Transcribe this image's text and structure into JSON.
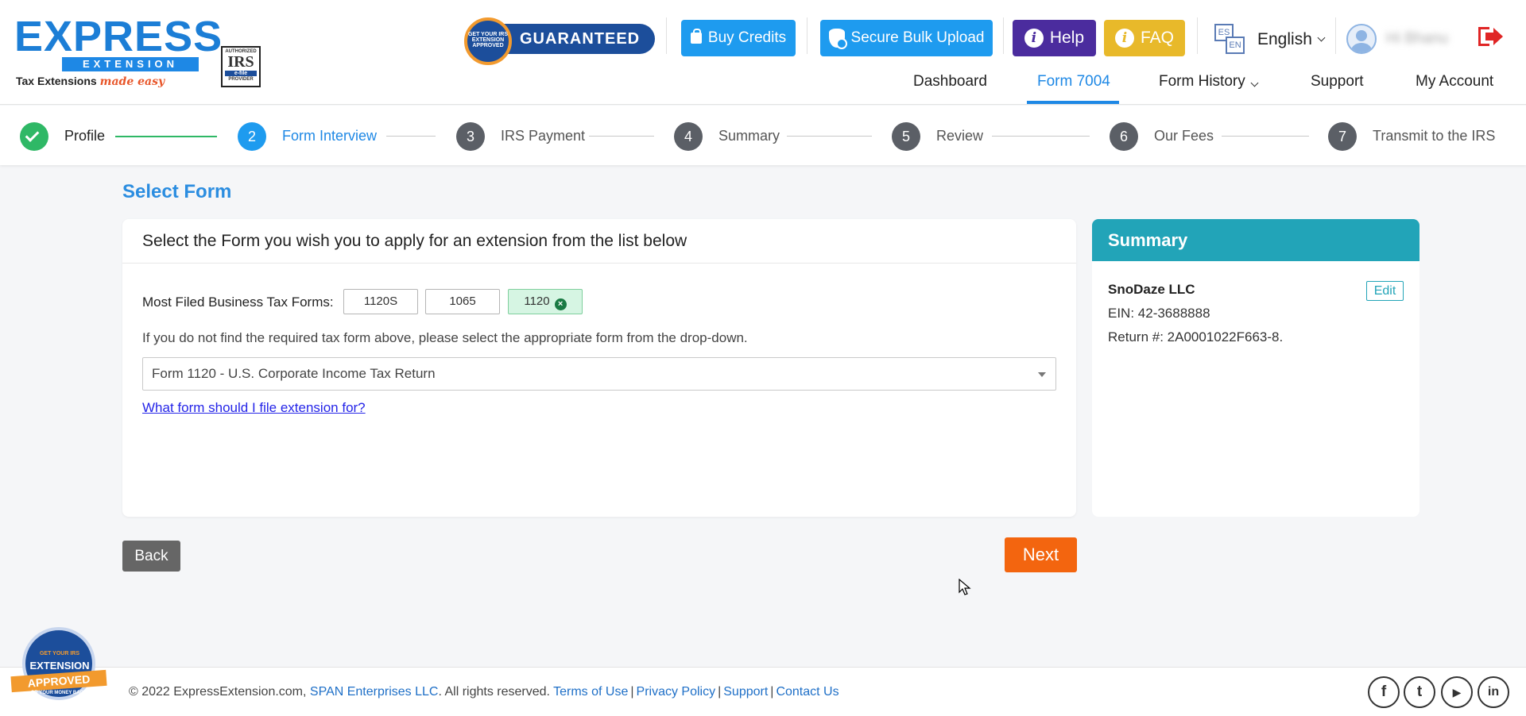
{
  "brand": {
    "logo_word": "EXPRESS",
    "logo_band": "EXTENSION",
    "logo_tag": "Tax Extensions",
    "logo_tag_script": "made easy",
    "irs_badge": {
      "line1": "AUTHORIZED",
      "line2": "IRS",
      "line3": "e-file",
      "line4": "PROVIDER"
    },
    "guaranteed_seal": "GET YOUR IRS EXTENSION APPROVED",
    "guaranteed": "GUARANTEED"
  },
  "header": {
    "buy_credits": "Buy Credits",
    "bulk_upload": "Secure Bulk Upload",
    "help": "Help",
    "faq": "FAQ",
    "language": "English",
    "lang_icon_es": "ES",
    "lang_icon_en": "EN",
    "username": "Hi Bhanu"
  },
  "nav": {
    "items": [
      {
        "label": "Dashboard"
      },
      {
        "label": "Form 7004",
        "active": true
      },
      {
        "label": "Form History"
      },
      {
        "label": "Support"
      },
      {
        "label": "My Account"
      }
    ]
  },
  "stepper": {
    "steps": [
      {
        "number": "",
        "label": "Profile",
        "state": "done"
      },
      {
        "number": "2",
        "label": "Form Interview",
        "state": "active"
      },
      {
        "number": "3",
        "label": "IRS Payment",
        "state": "pending"
      },
      {
        "number": "4",
        "label": "Summary",
        "state": "pending"
      },
      {
        "number": "5",
        "label": "Review",
        "state": "pending"
      },
      {
        "number": "6",
        "label": "Our Fees",
        "state": "pending"
      },
      {
        "number": "7",
        "label": "Transmit to the IRS",
        "state": "pending"
      }
    ]
  },
  "main": {
    "title": "Select Form",
    "card_heading": "Select the Form you wish you to apply for an extension from the list below",
    "most_filed_label": "Most Filed Business Tax Forms:",
    "quick_forms": [
      {
        "label": "1120S",
        "selected": false
      },
      {
        "label": "1065",
        "selected": false
      },
      {
        "label": "1120",
        "selected": true
      }
    ],
    "clear_glyph": "×",
    "dropdown_hint": "If you do not find the required tax form above, please select the appropriate form from the drop-down.",
    "dropdown_value": "Form 1120 - U.S. Corporate Income Tax Return",
    "help_link": "What form should I file extension for?"
  },
  "summary": {
    "title": "Summary",
    "company": "SnoDaze LLC",
    "edit": "Edit",
    "ein": "EIN: 42-3688888",
    "return_no": "Return #: 2A0001022F663-8."
  },
  "actions": {
    "back": "Back",
    "next": "Next"
  },
  "footer": {
    "copyright": "© 2022 ExpressExtension.com,",
    "company_link": "SPAN Enterprises LLC",
    "rights": ". All rights reserved.",
    "links": [
      "Terms of Use",
      "Privacy Policy",
      "Support",
      "Contact Us"
    ],
    "badge": {
      "line1": "GET YOUR IRS",
      "line2": "EXTENSION",
      "ribbon": "APPROVED",
      "line3": "OR YOUR MONEY BACK"
    },
    "social": [
      "f",
      "t",
      "▶",
      "in"
    ]
  },
  "colors": {
    "primary_blue": "#1e88e5",
    "next_orange": "#f3650f",
    "summary_teal": "#22a4b8",
    "help_purple": "#4b2c9e",
    "faq_yellow": "#e8b92a",
    "done_green": "#2fb866"
  }
}
